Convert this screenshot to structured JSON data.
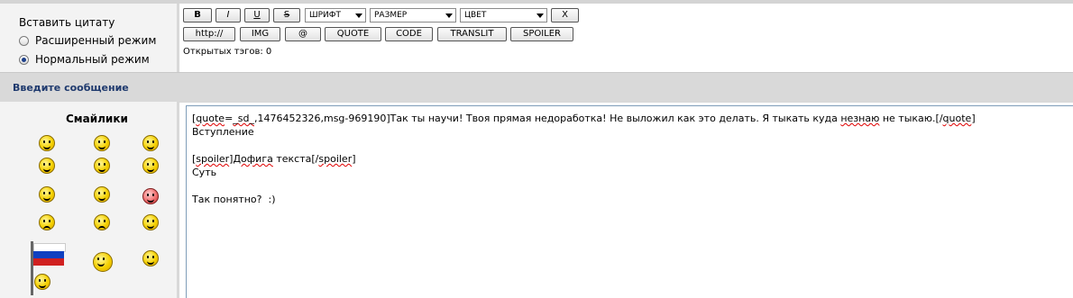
{
  "quote_panel": {
    "title": "Вставить цитату",
    "options": [
      {
        "label": "Расширенный режим",
        "checked": false
      },
      {
        "label": "Нормальный режим",
        "checked": true
      }
    ]
  },
  "toolbar": {
    "bold": "B",
    "italic": "I",
    "underline": "U",
    "strike": "S",
    "font_select": "ШРИФТ",
    "size_select": "РАЗМЕР",
    "color_select": "ЦВЕТ",
    "close": "X",
    "http": "http://",
    "img": "IMG",
    "at": "@",
    "quote": "QUOTE",
    "code": "CODE",
    "translit": "TRANSLIT",
    "spoiler": "SPOILER",
    "open_tags": "Открытых тэгов: 0"
  },
  "message_bar": {
    "label": "Введите сообщение"
  },
  "smileys": {
    "title": "Смайлики",
    "icons": [
      "smile-icon",
      "laugh-icon",
      "smile-icon",
      "grin-icon",
      "laugh-icon",
      "wink-icon",
      "sleepy-icon",
      "smile-icon",
      "love-icon",
      "angry-icon",
      "sad-icon",
      "shocked-icon",
      "flag-smiley-icon",
      "angel-icon",
      "eyes-icon"
    ]
  },
  "message": {
    "lines": [
      {
        "parts": [
          {
            "t": "["
          },
          {
            "t": "quote",
            "spell": true
          },
          {
            "t": "="
          },
          {
            "t": "_sd_",
            "spell": true
          },
          {
            "t": ",1476452326,msg-969190]Так ты научи! Твоя прямая недоработка! Не выложил как это делать. Я тыкать куда "
          },
          {
            "t": "незнаю",
            "spell": true
          },
          {
            "t": " не тыкаю.[/"
          },
          {
            "t": "quote",
            "spell": true
          },
          {
            "t": "]"
          }
        ]
      },
      {
        "parts": [
          {
            "t": "Вступление"
          }
        ]
      },
      {
        "parts": [
          {
            "t": ""
          }
        ]
      },
      {
        "parts": [
          {
            "t": "["
          },
          {
            "t": "spoiler",
            "spell": true
          },
          {
            "t": "]"
          },
          {
            "t": "Дофига",
            "spell": true
          },
          {
            "t": " текста[/"
          },
          {
            "t": "spoiler",
            "spell": true
          },
          {
            "t": "]"
          }
        ]
      },
      {
        "parts": [
          {
            "t": "Суть"
          }
        ]
      },
      {
        "parts": [
          {
            "t": ""
          }
        ]
      },
      {
        "parts": [
          {
            "t": "Так понятно?  :)"
          }
        ]
      }
    ]
  }
}
